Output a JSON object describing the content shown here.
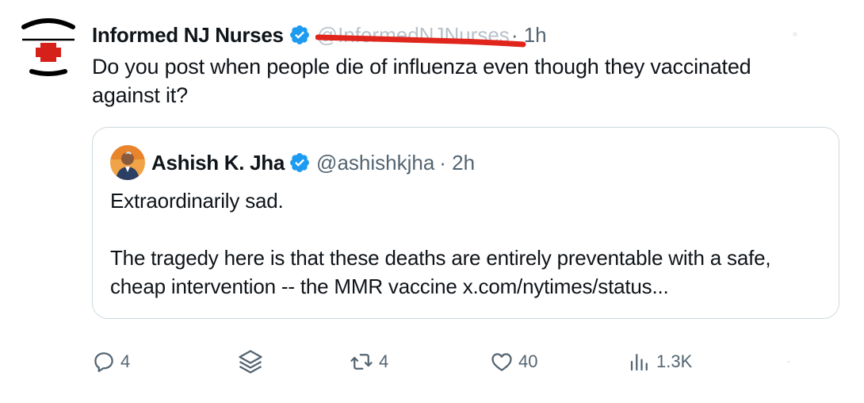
{
  "tweet": {
    "author": {
      "display_name": "Informed NJ Nurses",
      "handle": "@InformedNJNurses",
      "verified": true,
      "avatar_icon": "nurse-cap-red-cross-icon"
    },
    "time": "· 1h",
    "text": "Do you post when people die of influenza even though they vaccinated against it?"
  },
  "quote": {
    "author": {
      "display_name": "Ashish K. Jha",
      "handle": "@ashishkjha",
      "verified": true,
      "avatar_icon": "profile-photo"
    },
    "time": "· 2h",
    "text": "Extraordinarily sad.\n\nThe tragedy here is that these deaths are entirely preventable with a safe, cheap intervention -- the MMR vaccine x.com/nytimes/status..."
  },
  "actions": {
    "reply": {
      "icon": "reply-icon",
      "count": "4"
    },
    "grok": {
      "icon": "layers-icon"
    },
    "retweet": {
      "icon": "retweet-icon",
      "count": "4"
    },
    "like": {
      "icon": "heart-icon",
      "count": "40"
    },
    "views": {
      "icon": "views-icon",
      "count": "1.3K"
    }
  },
  "colors": {
    "text": "#0f1419",
    "muted": "#536471",
    "border": "#cfd9de",
    "verified": "#1d9bf0",
    "redaction": "#e0251c",
    "red_cross": "#d6201a"
  }
}
